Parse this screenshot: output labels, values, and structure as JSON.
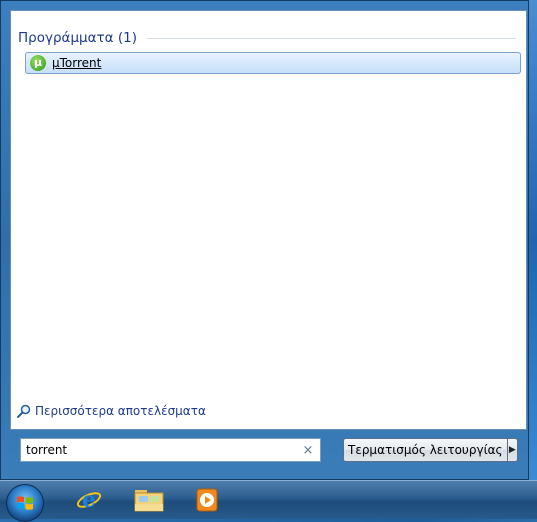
{
  "start_menu": {
    "section_title": "Προγράμματα (1)",
    "results": [
      {
        "label": "µTorrent",
        "icon": "utorrent-icon",
        "icon_glyph": "µ"
      }
    ],
    "more_results_label": "Περισσότερα αποτελέσματα",
    "search": {
      "value": "torrent",
      "clear_glyph": "×"
    },
    "shutdown": {
      "label": "Τερματισμός λειτουργίας",
      "arrow_glyph": "▶"
    }
  },
  "taskbar": {
    "items": [
      {
        "name": "start-orb",
        "icon": "windows-logo-icon"
      },
      {
        "name": "internet-explorer",
        "icon": "internet-explorer-icon"
      },
      {
        "name": "windows-explorer",
        "icon": "folder-icon"
      },
      {
        "name": "media-player",
        "icon": "media-player-icon"
      }
    ]
  },
  "colors": {
    "accent_text": "#1e3a8f",
    "selection_bg": "#d6e8fb",
    "taskbar": "#2b5d8e"
  }
}
